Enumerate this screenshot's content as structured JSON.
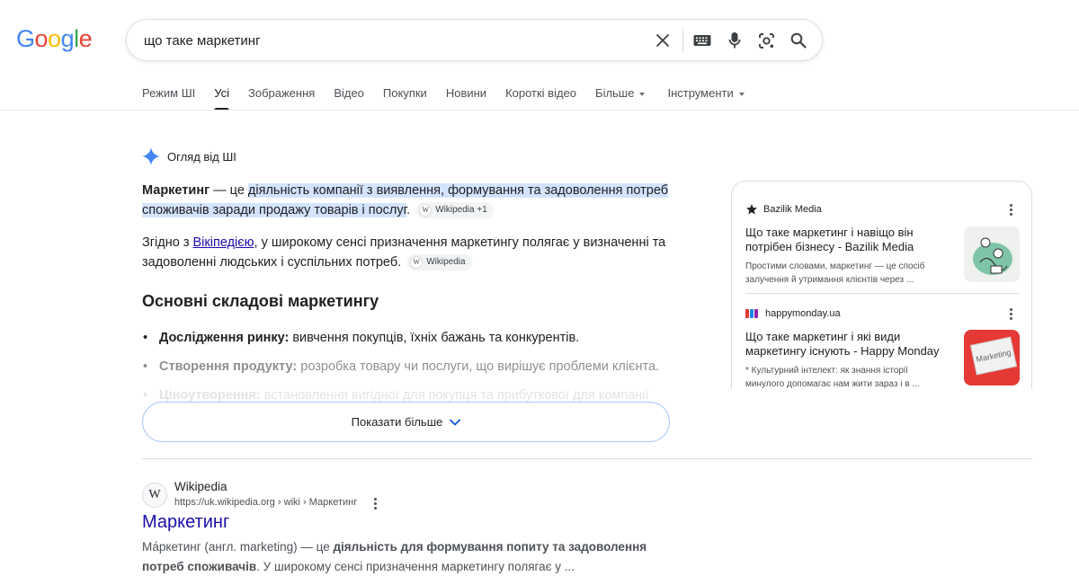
{
  "logo": {
    "letters": [
      "G",
      "o",
      "o",
      "g",
      "l",
      "e"
    ],
    "colors": [
      "#4285F4",
      "#EA4335",
      "#FBBC05",
      "#4285F4",
      "#34A853",
      "#EA4335"
    ]
  },
  "search": {
    "query": "що таке маркетинг",
    "icons": [
      "close-icon",
      "keyboard-icon",
      "mic-icon",
      "lens-icon",
      "search-icon"
    ]
  },
  "tabs": [
    {
      "label": "Режим ШІ"
    },
    {
      "label": "Усі",
      "active": true
    },
    {
      "label": "Зображення"
    },
    {
      "label": "Відео"
    },
    {
      "label": "Покупки"
    },
    {
      "label": "Новини"
    },
    {
      "label": "Короткі відео"
    },
    {
      "label": "Більше",
      "dropdown": true
    },
    {
      "label": "Інструменти",
      "dropdown": true
    }
  ],
  "ai": {
    "heading": "Огляд від ШІ",
    "p1": {
      "bold": "Маркетинг",
      "dash": " — це ",
      "highlight": "діяльність компанії з виявлення, формування та задоволення потреб споживачів заради продажу товарів і послуг",
      "end": ".",
      "chip": "Wikipedia +1"
    },
    "p2": {
      "before": "Згідно з ",
      "link": "Вікіпедією",
      "after": ", у широкому сенсі призначення маркетингу полягає у визначенні та задоволенні людських і суспільних потреб.",
      "chip": "Wikipedia"
    },
    "subheading": "Основні складові маркетингу",
    "bullets": [
      {
        "term": "Дослідження ринку:",
        "text": " вивчення покупців, їхніх бажань та конкурентів."
      },
      {
        "term": "Створення продукту:",
        "text": " розробка товару чи послуги, що вирішує проблеми клієнта."
      },
      {
        "term": "Ціноутворення:",
        "text": " встановлення вигідної для покупця та прибуткової для компанії"
      }
    ],
    "show_more": "Показати більше"
  },
  "sources": [
    {
      "site": "Bazilik Media",
      "title": "Що таке маркетинг і навіщо він потрібен бізнесу - Bazilik Media",
      "desc": "Простими словами, маркетинг — це спосіб залучення й утримання клієнтів через ..."
    },
    {
      "site": "happymonday.ua",
      "title": "Що таке маркетинг і які види маркетингу існують - Happy Monday",
      "desc": "* Культурний інтелект: як знання історії минулого допомагає нам жити зараз і в ...",
      "thumb_text": "Marketing"
    }
  ],
  "result": {
    "favicon": "W",
    "site": "Wikipedia",
    "url": "https://uk.wikipedia.org › wiki › Маркетинг",
    "title": "Маркетинг",
    "snippet_a": "Ма́ркетинг (англ. marketing) — це ",
    "snippet_bold_1": "діяльність для формування попиту та задоволення потреб споживачів",
    "snippet_b": ". У широкому сенсі призначення маркетингу полягає у ..."
  },
  "colors": {
    "link": "#1a0dab",
    "highlight": "#d3e3fd",
    "spark": "#4285F4"
  }
}
